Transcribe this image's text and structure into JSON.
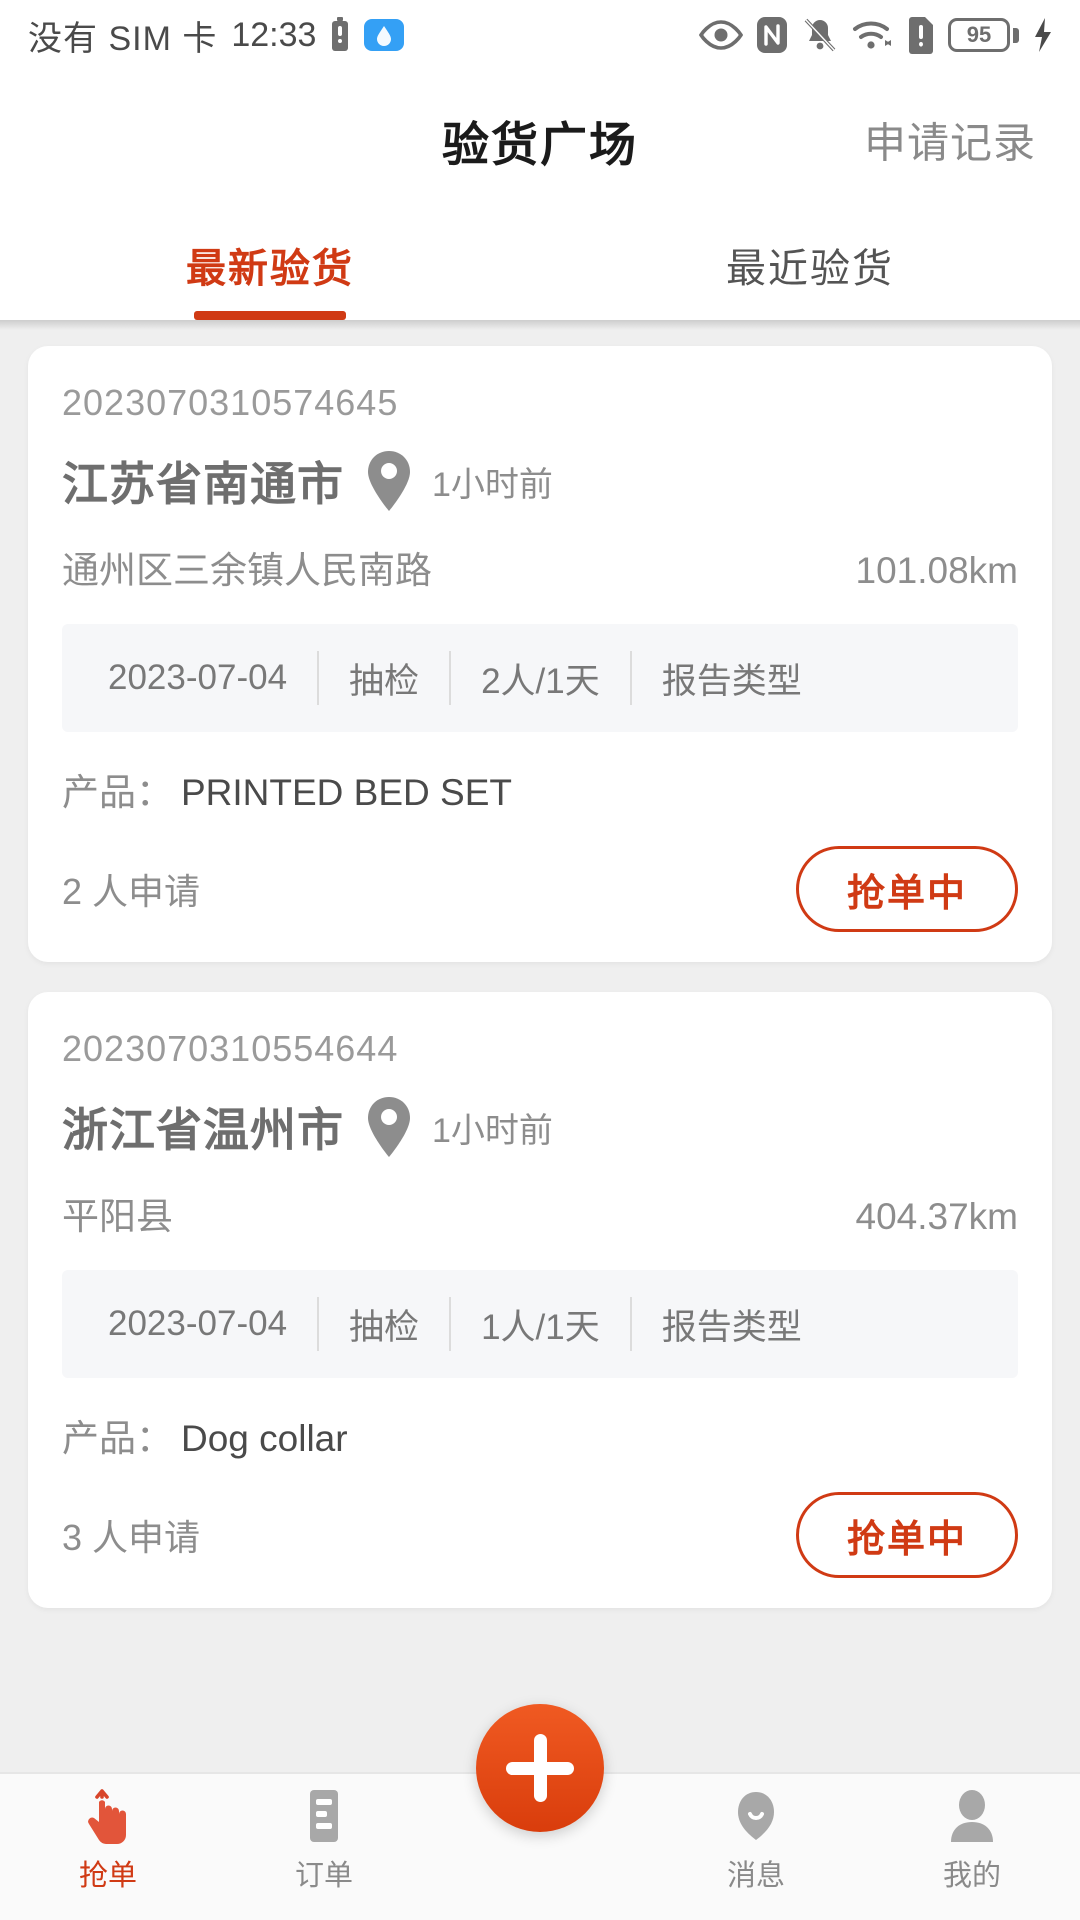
{
  "status_bar": {
    "carrier": "没有 SIM 卡",
    "time": "12:33",
    "battery_percent": "95",
    "icons_left": [
      "sim-battery-icon",
      "cloud-icon"
    ],
    "icons_right": [
      "eye-icon",
      "nfc-icon",
      "bell-off-icon",
      "wifi-icon",
      "sim-alert-icon",
      "battery-icon",
      "charging-bolt-icon"
    ]
  },
  "header": {
    "title": "验货广场",
    "action_label": "申请记录"
  },
  "tabs": [
    {
      "label": "最新验货",
      "active": true
    },
    {
      "label": "最近验货",
      "active": false
    }
  ],
  "colors": {
    "accent": "#d03a14",
    "fab": "#e8450f",
    "page_bg": "#efefef",
    "card_bg": "#ffffff",
    "meta_bg": "#f6f7f9",
    "muted_text": "#8d8d8d"
  },
  "cards": [
    {
      "order_no": "2023070310574645",
      "city": "江苏省南通市",
      "time_ago": "1小时前",
      "address": "通州区三余镇人民南路",
      "distance": "101.08km",
      "meta": [
        "2023-07-04",
        "抽检",
        "2人/1天",
        "报告类型"
      ],
      "product_label": "产品：",
      "product_value": "PRINTED BED SET",
      "applicants": "2 人申请",
      "action_label": "抢单中"
    },
    {
      "order_no": "2023070310554644",
      "city": "浙江省温州市",
      "time_ago": "1小时前",
      "address": "平阳县",
      "distance": "404.37km",
      "meta": [
        "2023-07-04",
        "抽检",
        "1人/1天",
        "报告类型"
      ],
      "product_label": "产品：",
      "product_value": "Dog collar",
      "applicants": "3 人申请",
      "action_label": "抢单中"
    }
  ],
  "bottom_nav": {
    "items": [
      {
        "label": "抢单",
        "icon": "tap-hand-icon",
        "active": true
      },
      {
        "label": "订单",
        "icon": "order-list-icon",
        "active": false
      },
      {
        "label": "消息",
        "icon": "message-icon",
        "active": false
      },
      {
        "label": "我的",
        "icon": "person-icon",
        "active": false
      }
    ],
    "fab": {
      "icon": "plus-icon"
    }
  }
}
